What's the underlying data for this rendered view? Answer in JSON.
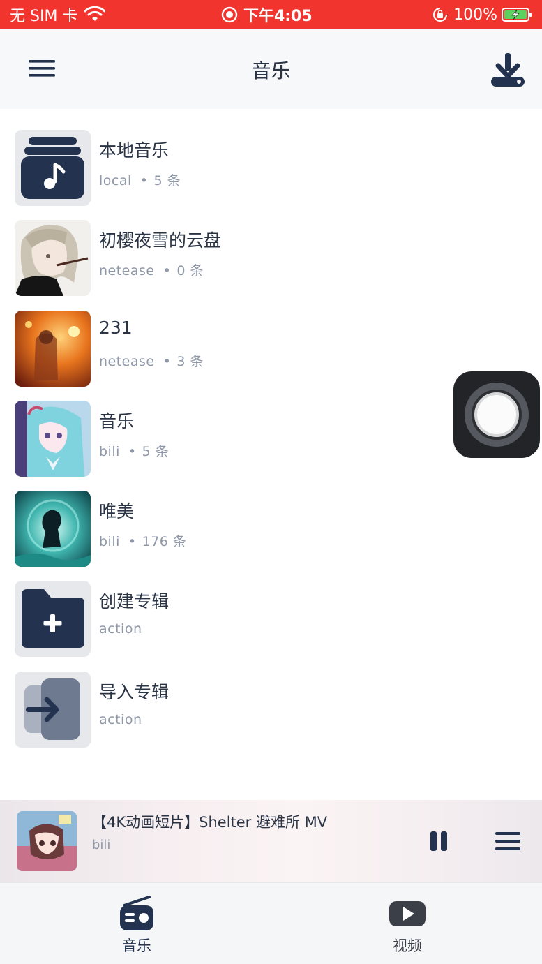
{
  "status_bar": {
    "carrier": "无 SIM 卡",
    "time": "下午4:05",
    "battery": "100%"
  },
  "header": {
    "title": "音乐",
    "menu_icon": "hamburger-menu-icon",
    "action_icon": "download-icon"
  },
  "albums": [
    {
      "title": "本地音乐",
      "source": "local",
      "count": "5 条",
      "cover": "local-music-icon"
    },
    {
      "title": "初樱夜雪的云盘",
      "source": "netease",
      "count": "0 条",
      "cover": "anime-girl-cover"
    },
    {
      "title": "231",
      "source": "netease",
      "count": "3 条",
      "cover": "orange-lantern-cover"
    },
    {
      "title": "音乐",
      "source": "bili",
      "count": "5 条",
      "cover": "blue-hair-girl-cover"
    },
    {
      "title": "唯美",
      "source": "bili",
      "count": "176 条",
      "cover": "teal-silhouette-cover"
    },
    {
      "title": "创建专辑",
      "source": "action",
      "count": "",
      "cover": "create-folder-icon"
    },
    {
      "title": "导入专辑",
      "source": "action",
      "count": "",
      "cover": "import-icon"
    }
  ],
  "mini_player": {
    "title": "【4K动画短片】Shelter 避难所 MV",
    "source": "bili",
    "state": "playing"
  },
  "tabs": [
    {
      "label": "音乐",
      "icon": "radio-icon",
      "active": true
    },
    {
      "label": "视频",
      "icon": "video-play-icon",
      "active": false
    }
  ],
  "colors": {
    "status_bar": "#f1352e",
    "accent": "#22324f",
    "subtitle": "#8f98a8"
  }
}
